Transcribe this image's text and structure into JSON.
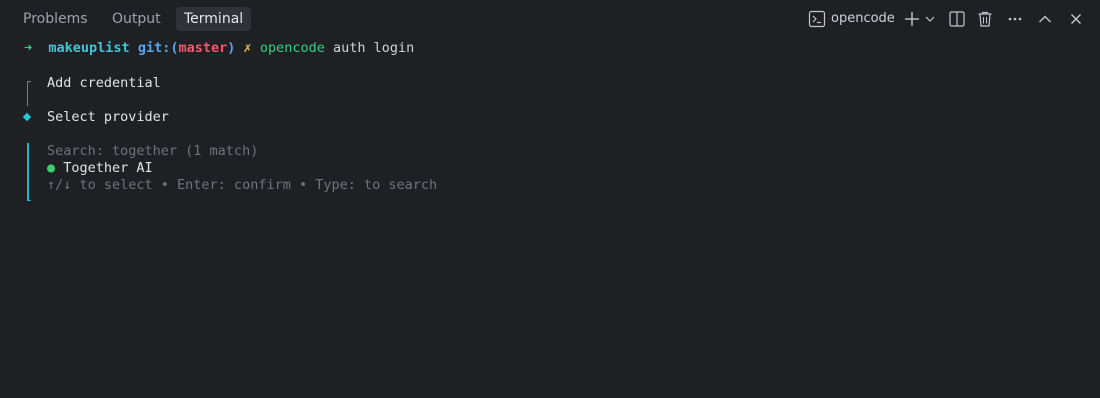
{
  "tabs": {
    "problems": "Problems",
    "output": "Output",
    "terminal": "Terminal"
  },
  "toolbar": {
    "terminal_name": "opencode",
    "icons": [
      "terminal-icon",
      "plus-icon",
      "chevron-down-icon",
      "split-icon",
      "trash-icon",
      "more-icon",
      "chevron-up-icon",
      "close-icon"
    ]
  },
  "terminal": {
    "prompt_arrow": "➜",
    "repo": "makeuplist",
    "git_prefix": "git:(",
    "branch": "master",
    "git_suffix": ")",
    "dirty_mark": "✗",
    "command": "opencode",
    "args": "auth login",
    "step1": "Add credential",
    "step2": "Select provider",
    "search": "Search: together (1 match)",
    "option_dot": "●",
    "option": "Together AI",
    "hint": "↑/↓ to select • Enter: confirm • Type: to search"
  },
  "colors": {
    "background": "#1e2024",
    "accent": "#23b7cc",
    "success": "#3fcf6a",
    "branch": "#f05a6a"
  }
}
